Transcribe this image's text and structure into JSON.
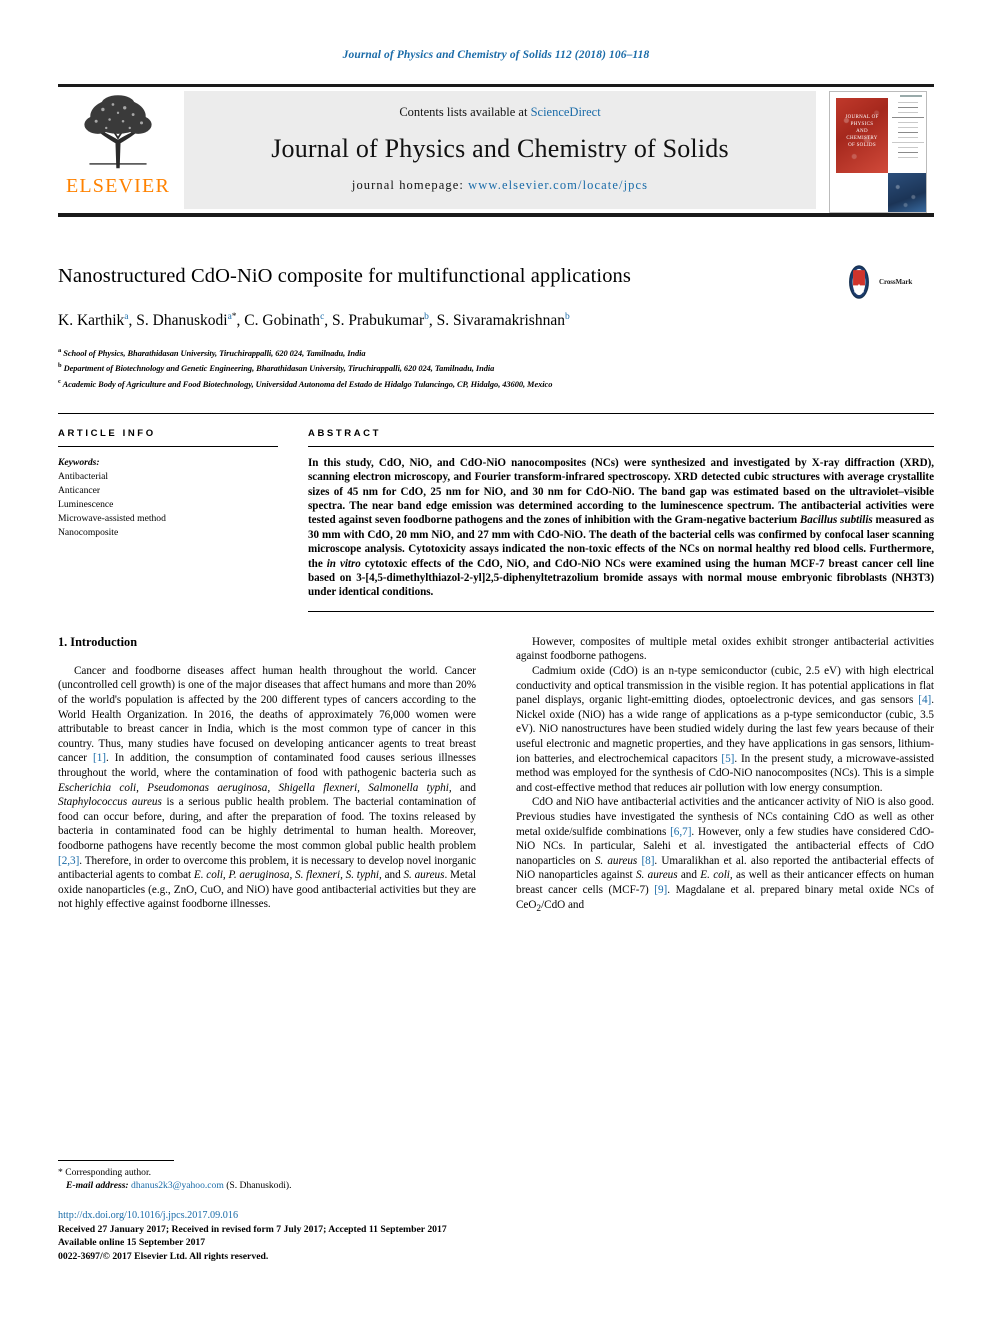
{
  "running_head": "Journal of Physics and Chemistry of Solids 112 (2018) 106–118",
  "masthead": {
    "publisher": "ELSEVIER",
    "contents_prefix": "Contents lists available at ",
    "contents_link": "ScienceDirect",
    "journal_title": "Journal of Physics and Chemistry of Solids",
    "homepage_label": "journal homepage: ",
    "homepage_url": "www.elsevier.com/locate/jpcs",
    "cover_title_lines": [
      "JOURNAL OF",
      "PHYSICS",
      "AND",
      "CHEMISTRY",
      "OF SOLIDS"
    ]
  },
  "article": {
    "title": "Nanostructured CdO-NiO composite for multifunctional applications",
    "crossmark_label": "CrossMark",
    "authors": [
      {
        "name": "K. Karthik",
        "sup": "a",
        "star": false
      },
      {
        "name": "S. Dhanuskodi",
        "sup": "a",
        "star": true
      },
      {
        "name": "C. Gobinath",
        "sup": "c",
        "star": false
      },
      {
        "name": "S. Prabukumar",
        "sup": "b",
        "star": false
      },
      {
        "name": "S. Sivaramakrishnan",
        "sup": "b",
        "star": false
      }
    ],
    "affiliations": [
      {
        "mark": "a",
        "text": "School of Physics, Bharathidasan University, Tiruchirappalli, 620 024, Tamilnadu, India"
      },
      {
        "mark": "b",
        "text": "Department of Biotechnology and Genetic Engineering, Bharathidasan University, Tiruchirappalli, 620 024, Tamilnadu, India"
      },
      {
        "mark": "c",
        "text": "Academic Body of Agriculture and Food Biotechnology, Universidad Autonoma del Estado de Hidalgo Tulancingo, CP, Hidalgo, 43600, Mexico"
      }
    ]
  },
  "article_info": {
    "heading": "ARTICLE INFO",
    "keywords_label": "Keywords:",
    "keywords": [
      "Antibacterial",
      "Anticancer",
      "Luminescence",
      "Microwave-assisted method",
      "Nanocomposite"
    ]
  },
  "abstract": {
    "heading": "ABSTRACT",
    "text": "In this study, CdO, NiO, and CdO-NiO nanocomposites (NCs) were synthesized and investigated by X-ray diffraction (XRD), scanning electron microscopy, and Fourier transform-infrared spectroscopy. XRD detected cubic structures with average crystallite sizes of 45 nm for CdO, 25 nm for NiO, and 30 nm for CdO-NiO. The band gap was estimated based on the ultraviolet–visible spectra. The near band edge emission was determined according to the luminescence spectrum. The antibacterial activities were tested against seven foodborne pathogens and the zones of inhibition with the Gram-negative bacterium ",
    "italic_1": "Bacillus subtilis",
    "text_2": " measured as 30 mm with CdO, 20 mm NiO, and 27 mm with CdO-NiO. The death of the bacterial cells was confirmed by confocal laser scanning microscope analysis. Cytotoxicity assays indicated the non-toxic effects of the NCs on normal healthy red blood cells. Furthermore, the ",
    "italic_2": "in vitro",
    "text_3": " cytotoxic effects of the CdO, NiO, and CdO-NiO NCs were examined using the human MCF-7 breast cancer cell line based on 3-[4,5-dimethylthiazol-2-yl]2,5-diphenyltetrazolium bromide assays with normal mouse embryonic fibroblasts (NH3T3) under identical conditions."
  },
  "introduction": {
    "heading": "1. Introduction",
    "left_p1_a": "Cancer and foodborne diseases affect human health throughout the world. Cancer (uncontrolled cell growth) is one of the major diseases that affect humans and more than 20% of the world's population is affected by the 200 different types of cancers according to the World Health Organization. In 2016, the deaths of approximately 76,000 women were attributable to breast cancer in India, which is the most common type of cancer in this country. Thus, many studies have focused on developing anticancer agents to treat breast cancer ",
    "ref1": "[1]",
    "left_p1_b": ". In addition, the consumption of contaminated food causes serious illnesses throughout the world, where the contamination of food with pathogenic bacteria such as ",
    "italic_sp1": "Escherichia coli, Pseudomonas aeruginosa, Shigella flexneri, Salmonella typhi,",
    "left_p1_c": " and ",
    "italic_sp2": "Staphylococcus aureus",
    "left_p1_d": " is a serious public health problem. The bacterial contamination of food can occur before, during, and after the preparation of food. The toxins released by bacteria in contaminated food can be highly detrimental to human health. Moreover, foodborne pathogens have recently become the most common global public health problem ",
    "ref23": "[2,3]",
    "left_p1_e": ". Therefore, in order to overcome this problem, it is necessary to develop novel inorganic antibacterial agents to combat ",
    "italic_sp3": "E. coli, P. aeruginosa, S. flexneri, S. typhi,",
    "left_p1_f": " and ",
    "italic_sp4": "S. aureus",
    "left_p1_g": ". Metal oxide nanoparticles (e.g., ZnO, CuO, and NiO) have good antibacterial activities but they are not highly effective against foodborne illnesses.",
    "right_p1": "However, composites of multiple metal oxides exhibit stronger antibacterial activities against foodborne pathogens.",
    "right_p2_a": "Cadmium oxide (CdO) is an n-type semiconductor (cubic, 2.5 eV) with high electrical conductivity and optical transmission in the visible region. It has potential applications in flat panel displays, organic light-emitting diodes, optoelectronic devices, and gas sensors ",
    "ref4": "[4]",
    "right_p2_b": ". Nickel oxide (NiO) has a wide range of applications as a p-type semiconductor (cubic, 3.5 eV). NiO nanostructures have been studied widely during the last few years because of their useful electronic and magnetic properties, and they have applications in gas sensors, lithium-ion batteries, and electrochemical capacitors ",
    "ref5": "[5]",
    "right_p2_c": ". In the present study, a microwave-assisted method was employed for the synthesis of CdO-NiO nanocomposites (NCs). This is a simple and cost-effective method that reduces air pollution with low energy consumption.",
    "right_p3_a": "CdO and NiO have antibacterial activities and the anticancer activity of NiO is also good. Previous studies have investigated the synthesis of NCs containing CdO as well as other metal oxide/sulfide combinations ",
    "ref67": "[6,7]",
    "right_p3_b": ". However, only a few studies have considered CdO-NiO NCs. In particular, Salehi et al. investigated the antibacterial effects of CdO nanoparticles on ",
    "italic_sp5": "S. aureus",
    "right_p3_c": " ",
    "ref8": "[8]",
    "right_p3_d": ". Umaralikhan et al. also reported the antibacterial effects of NiO nanoparticles against ",
    "italic_sp6": "S. aureus",
    "right_p3_e": " and ",
    "italic_sp7": "E. coli,",
    "right_p3_f": " as well as their anticancer effects on human breast cancer cells (MCF-7) ",
    "ref9": "[9]",
    "right_p3_g": ". Magdalane et al. prepared binary metal oxide NCs of CeO",
    "sub2": "2",
    "right_p3_h": "/CdO and"
  },
  "footer": {
    "corresponding_mark": "*",
    "corresponding_label": "Corresponding author.",
    "email_label": "E-mail address:",
    "email": "dhanus2k3@yahoo.com",
    "email_suffix": "(S. Dhanuskodi).",
    "doi": "http://dx.doi.org/10.1016/j.jpcs.2017.09.016",
    "history": "Received 27 January 2017; Received in revised form 7 July 2017; Accepted 11 September 2017",
    "available": "Available online 15 September 2017",
    "copyright": "0022-3697/© 2017 Elsevier Ltd. All rights reserved."
  },
  "colors": {
    "link_blue": "#1a6ba8",
    "elsevier_orange": "#ff8200",
    "masthead_grey": "#ececec"
  }
}
